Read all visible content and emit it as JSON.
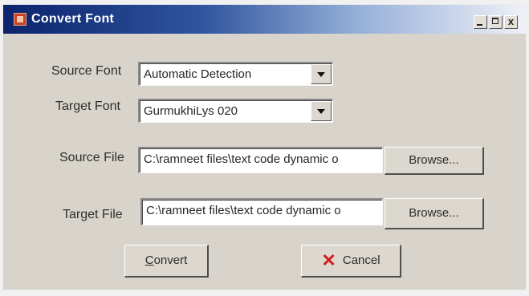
{
  "window": {
    "title": "Convert Font",
    "controls": {
      "minimize": "",
      "maximize": "",
      "close": "x"
    }
  },
  "form": {
    "source_font_label": "Source Font",
    "source_font_value": "Automatic Detection",
    "target_font_label": "Target Font",
    "target_font_value": "GurmukhiLys 020",
    "source_file_label": "Source File",
    "source_file_value": "C:\\ramneet files\\text code dynamic o",
    "source_browse_label": "Browse...",
    "target_file_label": "Target File",
    "target_file_value": "C:\\ramneet files\\text code dynamic o",
    "target_browse_label": "Browse..."
  },
  "actions": {
    "convert_label": "Convert",
    "cancel_label": "Cancel"
  },
  "icons": {
    "app": "app-icon",
    "minimize": "minimize-icon",
    "maximize": "maximize-icon",
    "close": "close-icon",
    "dropdown": "chevron-down-icon",
    "cancel": "x-icon"
  },
  "colors": {
    "titlebar_start": "#0a236c",
    "titlebar_end": "#eff1f7",
    "dialog_bg": "#d8d4cb",
    "cancel_icon": "#cf1d1d"
  }
}
